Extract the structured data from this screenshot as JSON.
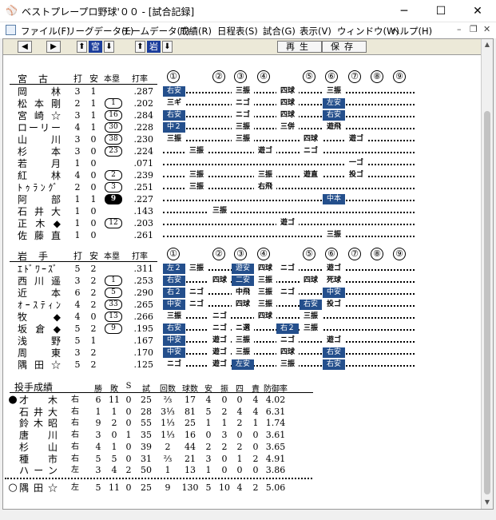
{
  "window": {
    "title": "ベストプレープロ野球'００ - [試合記録]",
    "min": "─",
    "max": "☐",
    "close": "✕"
  },
  "menu": [
    "ファイル(F)",
    "リーグデータ(L)",
    "チームデータ(T)",
    "成績(R)",
    "日程表(S)",
    "試合(G)",
    "表示(V)",
    "ウィンドウ(W)",
    "ヘルプ(H)"
  ],
  "toolbar": {
    "prev": "◀",
    "next": "▶",
    "up1": "⬆",
    "team1": "宮",
    "down1": "⬇",
    "up2": "⬆",
    "team2": "岩",
    "down2": "⬇",
    "play": "再生",
    "save": "保存"
  },
  "headers": {
    "at_bats": "打",
    "hits": "安",
    "home_runs": "本塁",
    "avg": "打率"
  },
  "innings": [
    "①",
    "②",
    "③",
    "④",
    "⑤",
    "⑥",
    "⑦",
    "⑧",
    "⑨"
  ],
  "team1": {
    "name": "宮　古",
    "players": [
      {
        "name": "岡　林",
        "ab": "3",
        "h": "1",
        "hr": "",
        "avg": ".287",
        "cells": [
          [
            "1",
            "右安",
            true
          ],
          [
            "4",
            "三振",
            false
          ],
          [
            "6",
            "四球",
            false
          ],
          [
            "8",
            "三振",
            false
          ]
        ]
      },
      {
        "name": "松本剛",
        "ab": "2",
        "h": "1",
        "hr": "1",
        "avg": ".202",
        "cells": [
          [
            "1",
            "三ギ",
            false
          ],
          [
            "4",
            "ニゴ",
            false
          ],
          [
            "6",
            "四球",
            false
          ],
          [
            "8",
            "左安",
            true
          ]
        ]
      },
      {
        "name": "宮崎☆",
        "ab": "3",
        "h": "1",
        "hr": "16",
        "avg": ".284",
        "cells": [
          [
            "1",
            "右安",
            true
          ],
          [
            "4",
            "ニゴ",
            false
          ],
          [
            "6",
            "四球",
            false
          ],
          [
            "8",
            "右安",
            true
          ]
        ]
      },
      {
        "name": "ローリー",
        "ab": "4",
        "h": "1",
        "hr": "30",
        "avg": ".228",
        "cells": [
          [
            "1",
            "中２",
            true
          ],
          [
            "4",
            "三振",
            false
          ],
          [
            "6",
            "三併",
            false
          ],
          [
            "8",
            "遊飛",
            false
          ]
        ]
      },
      {
        "name": "山　川",
        "ab": "3",
        "h": "0",
        "hr": "38",
        "avg": ".230",
        "cells": [
          [
            "1",
            "三振",
            false
          ],
          [
            "4",
            "三振",
            false
          ],
          [
            "7",
            "四球",
            false
          ],
          [
            "9",
            "遊ゴ",
            false
          ]
        ]
      },
      {
        "name": "杉　本",
        "ab": "3",
        "h": "0",
        "hr": "23",
        "avg": ".224",
        "cells": [
          [
            "2",
            "三振",
            false
          ],
          [
            "5",
            "遊ゴ",
            false
          ],
          [
            "7",
            "ニゴ",
            false
          ]
        ]
      },
      {
        "name": "若　月",
        "ab": "1",
        "h": "0",
        "hr": "",
        "avg": ".071",
        "cells": [
          [
            "9",
            "一ゴ",
            false
          ]
        ]
      },
      {
        "name": "紅　林",
        "ab": "4",
        "h": "0",
        "hr": "2",
        "avg": ".239",
        "cells": [
          [
            "2",
            "三振",
            false
          ],
          [
            "5",
            "三振",
            false
          ],
          [
            "7",
            "遊直",
            false
          ],
          [
            "9",
            "投ゴ",
            false
          ]
        ]
      },
      {
        "name": "ﾄｩﾗﾝｸﾞ",
        "ab": "2",
        "h": "0",
        "hr": "3",
        "avg": ".251",
        "cells": [
          [
            "2",
            "三振",
            false
          ],
          [
            "5",
            "右飛",
            false
          ]
        ]
      },
      {
        "name": "阿　部",
        "ab": "1",
        "h": "1",
        "hr": "9",
        "hrBlack": true,
        "avg": ".227",
        "cells": [
          [
            "8",
            "中本",
            true
          ]
        ]
      },
      {
        "name": "石井大",
        "ab": "1",
        "h": "0",
        "hr": "",
        "avg": ".143",
        "cells": [
          [
            "3",
            "三振",
            false
          ]
        ]
      },
      {
        "name": "正木◆",
        "ab": "1",
        "h": "0",
        "hr": "12",
        "avg": ".203",
        "cells": [
          [
            "6",
            "遊ゴ",
            false
          ]
        ]
      },
      {
        "name": "佐藤直",
        "ab": "1",
        "h": "0",
        "hr": "",
        "avg": ".261",
        "cells": [
          [
            "8",
            "三振",
            false
          ]
        ]
      }
    ]
  },
  "team2": {
    "name": "岩　手",
    "players": [
      {
        "name": "ｴﾄﾞﾜｰｽﾞ",
        "ab": "5",
        "h": "2",
        "hr": "",
        "avg": ".311",
        "cells": [
          [
            "1",
            "左２",
            true
          ],
          [
            "2",
            "三振",
            false
          ],
          [
            "4",
            "遊安",
            true
          ],
          [
            "5",
            "四球",
            false
          ],
          [
            "6",
            "ニゴ",
            false
          ],
          [
            "8",
            "遊ゴ",
            false
          ]
        ]
      },
      {
        "name": "西川遥",
        "ab": "3",
        "h": "2",
        "hr": "1",
        "avg": ".253",
        "cells": [
          [
            "1",
            "右安",
            true
          ],
          [
            "3",
            "四球",
            false
          ],
          [
            "4",
            "二安",
            true
          ],
          [
            "5",
            "三振",
            false
          ],
          [
            "7",
            "四球",
            false
          ],
          [
            "8",
            "死球",
            false
          ]
        ]
      },
      {
        "name": "近　本",
        "ab": "6",
        "h": "2",
        "hr": "5",
        "avg": ".290",
        "cells": [
          [
            "1",
            "右２",
            true
          ],
          [
            "2",
            "ニゴ",
            false
          ],
          [
            "4",
            "中飛",
            false
          ],
          [
            "5",
            "三振",
            false
          ],
          [
            "6",
            "ニゴ",
            false
          ],
          [
            "8",
            "中安",
            true
          ]
        ]
      },
      {
        "name": "ｵｰｽﾃｨﾝ",
        "ab": "4",
        "h": "2",
        "hr": "33",
        "avg": ".265",
        "cells": [
          [
            "1",
            "中安",
            true
          ],
          [
            "2",
            "ニゴ",
            false
          ],
          [
            "4",
            "四球",
            false
          ],
          [
            "5",
            "三振",
            false
          ],
          [
            "7",
            "右安",
            true
          ],
          [
            "8",
            "投ゴ",
            false
          ]
        ]
      },
      {
        "name": "牧　◆",
        "ab": "4",
        "h": "0",
        "hr": "13",
        "avg": ".266",
        "cells": [
          [
            "1",
            "三振",
            false
          ],
          [
            "3",
            "ニゴ",
            false
          ],
          [
            "5",
            "四球",
            false
          ],
          [
            "7",
            "三振",
            false
          ]
        ]
      },
      {
        "name": "坂倉◆",
        "ab": "5",
        "h": "2",
        "hr": "9",
        "avg": ".195",
        "cells": [
          [
            "1",
            "右安",
            true
          ],
          [
            "3",
            "ニゴ",
            false
          ],
          [
            "4",
            "ニ選",
            false
          ],
          [
            "6",
            "右２",
            true
          ],
          [
            "7",
            "三振",
            false
          ]
        ]
      },
      {
        "name": "浅　野",
        "ab": "5",
        "h": "1",
        "hr": "",
        "avg": ".167",
        "cells": [
          [
            "1",
            "中安",
            true
          ],
          [
            "3",
            "遊ゴ",
            false
          ],
          [
            "4",
            "三振",
            false
          ],
          [
            "6",
            "ニゴ",
            false
          ],
          [
            "8",
            "遊ゴ",
            false
          ]
        ]
      },
      {
        "name": "周　東",
        "ab": "3",
        "h": "2",
        "hr": "",
        "avg": ".170",
        "cells": [
          [
            "1",
            "中安",
            true
          ],
          [
            "3",
            "遊ゴ",
            false
          ],
          [
            "4",
            "三振",
            false
          ],
          [
            "6",
            "四球",
            false
          ],
          [
            "8",
            "右安",
            true
          ]
        ]
      },
      {
        "name": "隅田☆",
        "ab": "5",
        "h": "2",
        "hr": "",
        "avg": ".125",
        "cells": [
          [
            "1",
            "ニゴ",
            false
          ],
          [
            "3",
            "遊ゴ",
            false
          ],
          [
            "4",
            "左安",
            true
          ],
          [
            "6",
            "三振",
            false
          ],
          [
            "8",
            "右安",
            true
          ]
        ]
      }
    ]
  },
  "pitching": {
    "title": "投手成績",
    "headers": [
      "勝",
      "敗",
      "S",
      "試",
      "回数",
      "球数",
      "安",
      "振",
      "四",
      "責",
      "防御率"
    ],
    "pitchers": [
      {
        "mark": "●",
        "name": "才　木",
        "hand": "右",
        "w": "6",
        "l": "11",
        "s": "0",
        "g": "25",
        "ip": "⅔",
        "np": "17",
        "h": "4",
        "so": "0",
        "bb": "0",
        "er": "4",
        "era": "4.02"
      },
      {
        "mark": "",
        "name": "石井大",
        "hand": "右",
        "w": "1",
        "l": "1",
        "s": "0",
        "g": "28",
        "ip": "3⅓",
        "np": "81",
        "h": "5",
        "so": "2",
        "bb": "4",
        "er": "4",
        "era": "6.31"
      },
      {
        "mark": "",
        "name": "鈴木昭",
        "hand": "右",
        "w": "9",
        "l": "2",
        "s": "0",
        "g": "55",
        "ip": "1⅓",
        "np": "25",
        "h": "1",
        "so": "1",
        "bb": "2",
        "er": "1",
        "era": "1.74"
      },
      {
        "mark": "",
        "name": "唐　川",
        "hand": "右",
        "w": "3",
        "l": "0",
        "s": "1",
        "g": "35",
        "ip": "1⅓",
        "np": "16",
        "h": "0",
        "so": "3",
        "bb": "0",
        "er": "0",
        "era": "3.61"
      },
      {
        "mark": "",
        "name": "杉　山",
        "hand": "右",
        "w": "4",
        "l": "1",
        "s": "0",
        "g": "39",
        "ip": "2",
        "np": "44",
        "h": "2",
        "so": "2",
        "bb": "2",
        "er": "0",
        "era": "3.65"
      },
      {
        "mark": "",
        "name": "種　市",
        "hand": "右",
        "w": "5",
        "l": "5",
        "s": "0",
        "g": "31",
        "ip": "⅔",
        "np": "21",
        "h": "3",
        "so": "0",
        "bb": "1",
        "er": "2",
        "era": "4.91"
      },
      {
        "mark": "",
        "name": "ハーン",
        "hand": "左",
        "w": "3",
        "l": "4",
        "s": "2",
        "g": "50",
        "ip": "1",
        "np": "13",
        "h": "1",
        "so": "0",
        "bb": "0",
        "er": "0",
        "era": "3.86"
      }
    ],
    "winner": {
      "mark": "○",
      "name": "隅田☆",
      "hand": "左",
      "w": "5",
      "l": "11",
      "s": "0",
      "g": "25",
      "ip": "9",
      "np": "130",
      "h": "5",
      "so": "10",
      "bb": "4",
      "er": "2",
      "era": "5.06"
    }
  }
}
